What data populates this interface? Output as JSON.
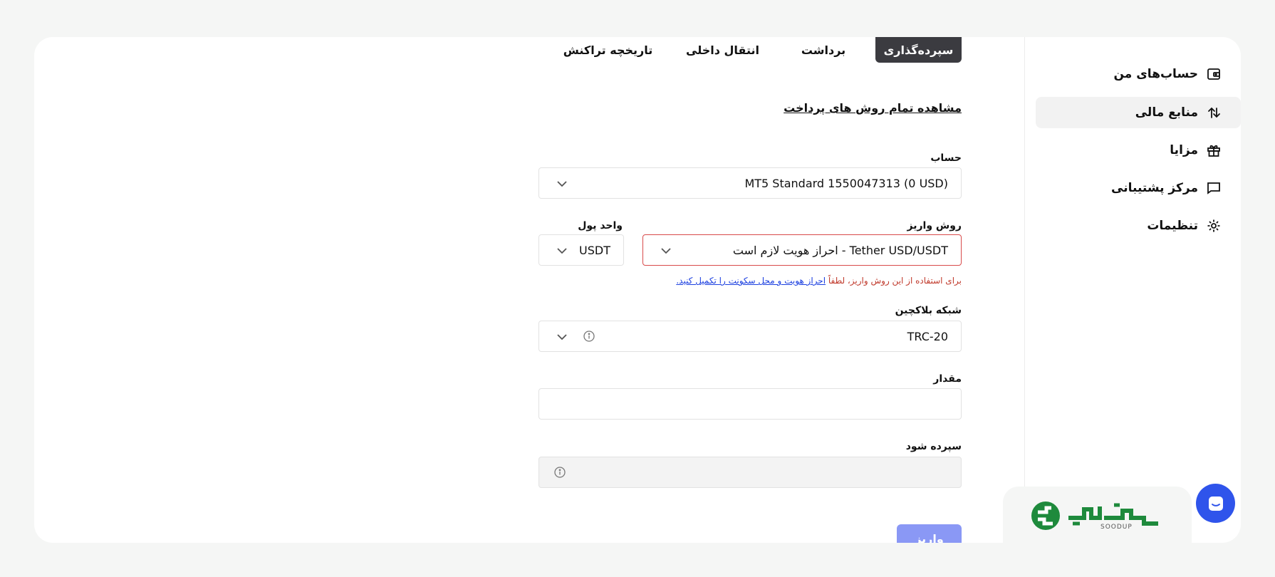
{
  "sidebar": {
    "items": [
      {
        "label": "حساب‌های من",
        "icon": "wallet-icon"
      },
      {
        "label": "منابع مالی",
        "icon": "transfer-arrows-icon"
      },
      {
        "label": "مزایا",
        "icon": "gift-icon"
      },
      {
        "label": "مرکز پشتیبانی",
        "icon": "chat-bubble-icon"
      },
      {
        "label": "تنظیمات",
        "icon": "gear-icon"
      }
    ],
    "active_index": 1
  },
  "tabs": [
    "سپرده‌گذاری",
    "برداشت",
    "انتقال داخلی",
    "تاریخچه تراکنش"
  ],
  "active_tab": 0,
  "view_all_link": "مشاهده تمام روش های پرداخت",
  "form": {
    "account_label": "حساب",
    "account_value": "MT5 Standard 1550047313 (0 USD)",
    "method_label": "روش واریز",
    "method_value": "Tether USD/USDT - احراز هویت لازم است",
    "currency_label": "واحد پول",
    "currency_value": "USDT",
    "error_prefix": "برای استفاده از این روش واریز، لطفاً",
    "error_link": "احراز هویت و محل سکونت را تکمیل کنید.",
    "network_label": "شبکه بلاکچین",
    "network_value": "TRC-20",
    "amount_label": "مقدار",
    "amount_value": "",
    "deposited_label": "سپرده شود",
    "deposited_value": "",
    "submit_label": "واریز"
  },
  "branding": {
    "logo_text": "SOODUP"
  },
  "colors": {
    "primary": "#2f54eb",
    "error": "#d84a4a",
    "active_tab": "#3b3b40",
    "logo_green": "#1e8a3c"
  }
}
